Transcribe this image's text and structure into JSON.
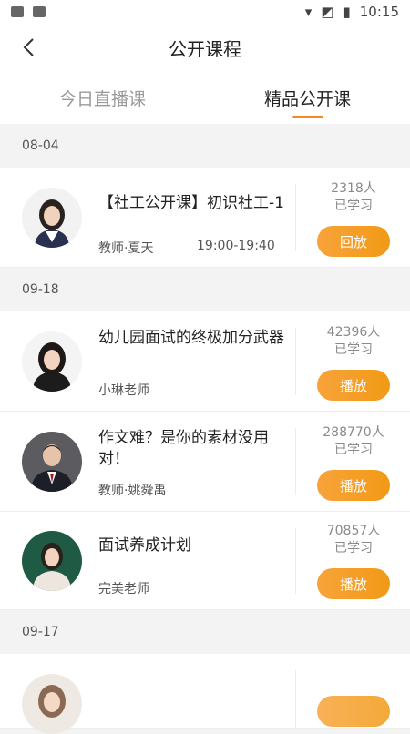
{
  "status": {
    "time": "10:15"
  },
  "header": {
    "title": "公开课程"
  },
  "tabs": [
    {
      "label": "今日直播课",
      "active": false
    },
    {
      "label": "精品公开课",
      "active": true
    }
  ],
  "sections": [
    {
      "date": "08-04",
      "courses": [
        {
          "title": "【社工公开课】初识社工-1",
          "teacher": "教师·夏天",
          "time": "19:00-19:40",
          "count": "2318人",
          "studied": "已学习",
          "button": "回放"
        }
      ]
    },
    {
      "date": "09-18",
      "courses": [
        {
          "title": "幼儿园面试的终极加分武器",
          "teacher": "小琳老师",
          "count": "42396人",
          "studied": "已学习",
          "button": "播放"
        },
        {
          "title": "作文难？是你的素材没用对！",
          "teacher": "教师·姚舜禹",
          "count": "288770人",
          "studied": "已学习",
          "button": "播放"
        },
        {
          "title": "面试养成计划",
          "teacher": "完美老师",
          "count": "70857人",
          "studied": "已学习",
          "button": "播放"
        }
      ]
    },
    {
      "date": "09-17",
      "courses": []
    }
  ],
  "colors": {
    "accent": "#f19a16",
    "tab_indicator": "#f28a1e"
  }
}
